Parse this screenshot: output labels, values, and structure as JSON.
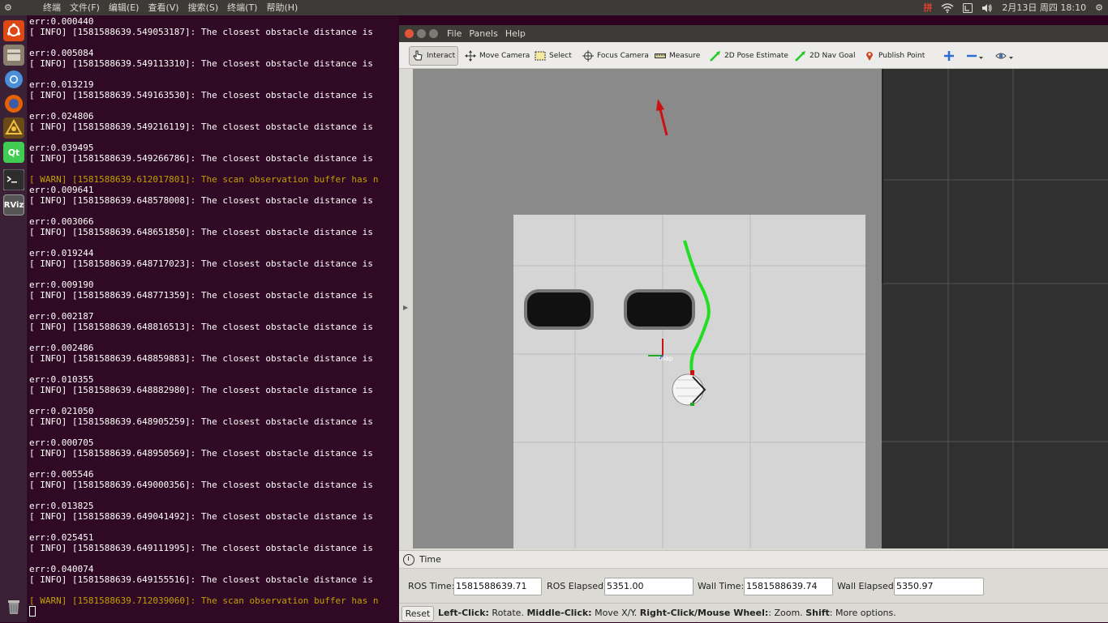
{
  "topbar": {
    "menus": [
      "终端",
      "文件(F)",
      "编辑(E)",
      "查看(V)",
      "搜索(S)",
      "终端(T)",
      "帮助(H)"
    ],
    "ime": "拼",
    "datetime": "2月13日 周四 18:10"
  },
  "launcher": [
    {
      "icon": "ubuntu-dash-icon",
      "color": "#dd4814",
      "label": ""
    },
    {
      "icon": "files-icon",
      "color": "#8a7f6f",
      "label": ""
    },
    {
      "icon": "chromium-icon",
      "color": "#4a8fd8",
      "label": ""
    },
    {
      "icon": "firefox-icon",
      "color": "#e66000",
      "label": ""
    },
    {
      "icon": "ros-app-icon",
      "color": "#6b4a1a",
      "label": ""
    },
    {
      "icon": "qt-creator-icon",
      "color": "#41cd52",
      "label": "Qt"
    },
    {
      "icon": "terminal-icon",
      "color": "#2d2d2d",
      "label": ""
    },
    {
      "icon": "rviz-icon",
      "color": "#555555",
      "label": "RViz"
    },
    {
      "icon": "trash-icon",
      "color": "#777777",
      "label": ""
    }
  ],
  "terminal_lines": [
    {
      "t": "err:0.000440",
      "w": false
    },
    {
      "t": "[ INFO] [1581588639.549053187]: The closest obstacle distance is ",
      "w": false
    },
    {
      "t": "",
      "w": false
    },
    {
      "t": "err:0.005084",
      "w": false
    },
    {
      "t": "[ INFO] [1581588639.549113310]: The closest obstacle distance is ",
      "w": false
    },
    {
      "t": "",
      "w": false
    },
    {
      "t": "err:0.013219",
      "w": false
    },
    {
      "t": "[ INFO] [1581588639.549163530]: The closest obstacle distance is ",
      "w": false
    },
    {
      "t": "",
      "w": false
    },
    {
      "t": "err:0.024806",
      "w": false
    },
    {
      "t": "[ INFO] [1581588639.549216119]: The closest obstacle distance is ",
      "w": false
    },
    {
      "t": "",
      "w": false
    },
    {
      "t": "err:0.039495",
      "w": false
    },
    {
      "t": "[ INFO] [1581588639.549266786]: The closest obstacle distance is ",
      "w": false
    },
    {
      "t": "",
      "w": false
    },
    {
      "t": "[ WARN] [1581588639.612017801]: The scan observation buffer has n",
      "w": true
    },
    {
      "t": "err:0.009641",
      "w": false
    },
    {
      "t": "[ INFO] [1581588639.648578008]: The closest obstacle distance is ",
      "w": false
    },
    {
      "t": "",
      "w": false
    },
    {
      "t": "err:0.003066",
      "w": false
    },
    {
      "t": "[ INFO] [1581588639.648651850]: The closest obstacle distance is ",
      "w": false
    },
    {
      "t": "",
      "w": false
    },
    {
      "t": "err:0.019244",
      "w": false
    },
    {
      "t": "[ INFO] [1581588639.648717023]: The closest obstacle distance is ",
      "w": false
    },
    {
      "t": "",
      "w": false
    },
    {
      "t": "err:0.009190",
      "w": false
    },
    {
      "t": "[ INFO] [1581588639.648771359]: The closest obstacle distance is ",
      "w": false
    },
    {
      "t": "",
      "w": false
    },
    {
      "t": "err:0.002187",
      "w": false
    },
    {
      "t": "[ INFO] [1581588639.648816513]: The closest obstacle distance is ",
      "w": false
    },
    {
      "t": "",
      "w": false
    },
    {
      "t": "err:0.002486",
      "w": false
    },
    {
      "t": "[ INFO] [1581588639.648859883]: The closest obstacle distance is ",
      "w": false
    },
    {
      "t": "",
      "w": false
    },
    {
      "t": "err:0.010355",
      "w": false
    },
    {
      "t": "[ INFO] [1581588639.648882980]: The closest obstacle distance is ",
      "w": false
    },
    {
      "t": "",
      "w": false
    },
    {
      "t": "err:0.021050",
      "w": false
    },
    {
      "t": "[ INFO] [1581588639.648905259]: The closest obstacle distance is ",
      "w": false
    },
    {
      "t": "",
      "w": false
    },
    {
      "t": "err:0.000705",
      "w": false
    },
    {
      "t": "[ INFO] [1581588639.648950569]: The closest obstacle distance is ",
      "w": false
    },
    {
      "t": "",
      "w": false
    },
    {
      "t": "err:0.005546",
      "w": false
    },
    {
      "t": "[ INFO] [1581588639.649000356]: The closest obstacle distance is ",
      "w": false
    },
    {
      "t": "",
      "w": false
    },
    {
      "t": "err:0.013825",
      "w": false
    },
    {
      "t": "[ INFO] [1581588639.649041492]: The closest obstacle distance is ",
      "w": false
    },
    {
      "t": "",
      "w": false
    },
    {
      "t": "err:0.025451",
      "w": false
    },
    {
      "t": "[ INFO] [1581588639.649111995]: The closest obstacle distance is ",
      "w": false
    },
    {
      "t": "",
      "w": false
    },
    {
      "t": "err:0.040074",
      "w": false
    },
    {
      "t": "[ INFO] [1581588639.649155516]: The closest obstacle distance is ",
      "w": false
    },
    {
      "t": "",
      "w": false
    },
    {
      "t": "[ WARN] [1581588639.712039060]: The scan observation buffer has n",
      "w": true
    }
  ],
  "rviz": {
    "menu": [
      "File",
      "Panels",
      "Help"
    ],
    "tools": {
      "interact": "Interact",
      "move_camera": "Move Camera",
      "select": "Select",
      "focus_camera": "Focus Camera",
      "measure": "Measure",
      "pose_estimate": "2D Pose Estimate",
      "nav_goal": "2D Nav Goal",
      "publish_point": "Publish Point"
    },
    "frame_label": "map",
    "time_panel": {
      "title": "Time",
      "ros_time_label": "ROS Time:",
      "ros_time": "1581588639.71",
      "ros_elapsed_label": "ROS Elapsed:",
      "ros_elapsed": "5351.00",
      "wall_time_label": "Wall Time:",
      "wall_time": "1581588639.74",
      "wall_elapsed_label": "Wall Elapsed:",
      "wall_elapsed": "5350.97"
    },
    "status": {
      "reset": "Reset",
      "h1b": "Left-Click:",
      "h1": " Rotate. ",
      "h2b": "Middle-Click:",
      "h2": " Move X/Y. ",
      "h3b": "Right-Click/Mouse Wheel:",
      "h3": ": Zoom. ",
      "h4b": "Shift",
      "h4": ": More options."
    },
    "colors": {
      "path": "#22dd22",
      "goal_arrow": "#cc1111",
      "obstacle": "#111111"
    }
  }
}
